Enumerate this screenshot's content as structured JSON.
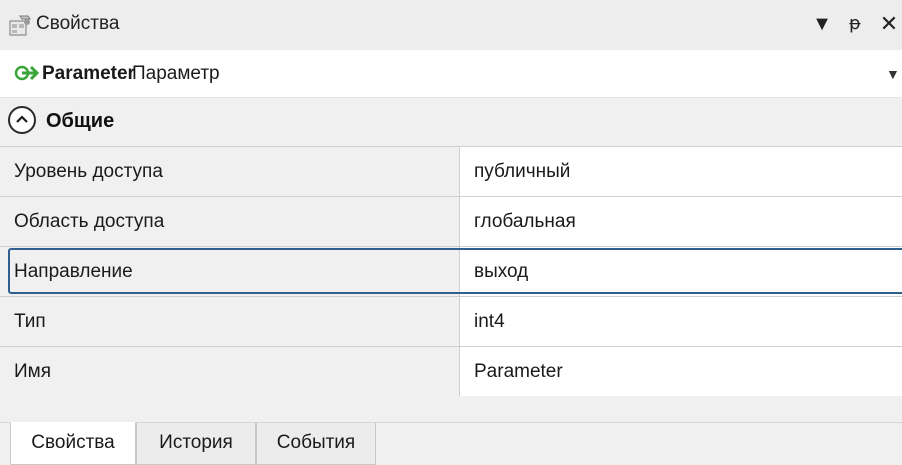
{
  "window": {
    "title": "Свойства",
    "dropdown_icon": "triangle-down-icon",
    "pin_label": "ᵽ",
    "close_label": "✕"
  },
  "object_selector": {
    "name": "Parameter",
    "type": "Параметр",
    "icon": "green-arrow-right-icon"
  },
  "section": {
    "title": "Общие",
    "icon": "collapse-up-icon"
  },
  "properties": [
    {
      "name": "Уровень доступа",
      "value": "публичный"
    },
    {
      "name": "Область доступа",
      "value": "глобальная"
    },
    {
      "name": "Направление",
      "value": "выход"
    },
    {
      "name": "Тип",
      "value": "int4"
    },
    {
      "name": "Имя",
      "value": "Parameter"
    }
  ],
  "tabs": [
    {
      "label": "Свойства",
      "active": true
    },
    {
      "label": "История",
      "active": false
    },
    {
      "label": "События",
      "active": false
    }
  ],
  "colors": {
    "selection_border": "#2d5f8f",
    "arrow_green": "#3aa63a"
  }
}
